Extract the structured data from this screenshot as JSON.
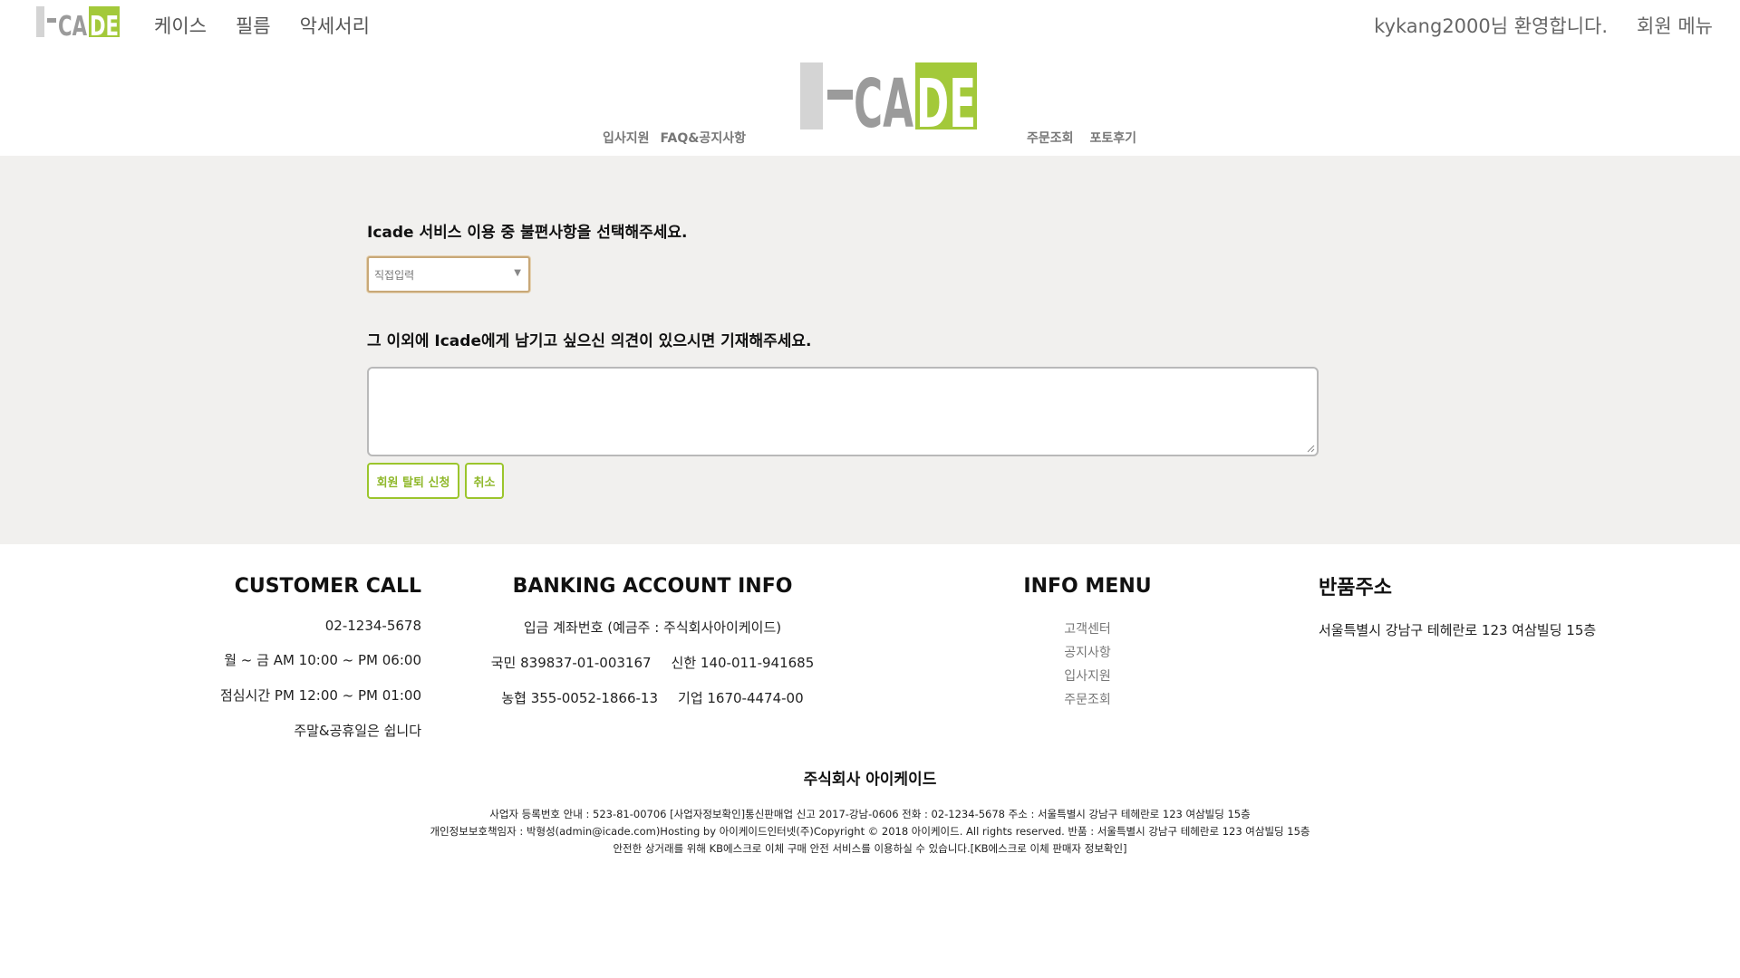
{
  "brand": {
    "logo_text_left": "I-CA",
    "logo_text_right": "DE",
    "colors": {
      "grey": "#9b9b9b",
      "light_grey": "#d4d4d4",
      "green": "#a3c93a"
    }
  },
  "header": {
    "top_nav": [
      "케이스",
      "필름",
      "악세서리"
    ],
    "welcome": "kykang2000님 환영합니다.",
    "member_menu": "회원 메뉴",
    "sub_nav_left": [
      "입사지원",
      "FAQ&공지사항"
    ],
    "sub_nav_right": [
      "주문조회",
      "포토후기"
    ]
  },
  "form": {
    "question1": "Icade 서비스 이용 중 불편사항을 선택해주세요.",
    "select_value": "직접입력",
    "question2": "그 이외에 Icade에게 남기고 싶으신 의견이 있으시면 기재해주세요.",
    "opinion_value": "",
    "withdraw_button": "회원 탈퇴 신청",
    "cancel_button": "취소"
  },
  "footer": {
    "customer_call": {
      "title": "CUSTOMER CALL",
      "lines": [
        "02-1234-5678",
        "월 ~ 금 AM 10:00 ~ PM 06:00",
        "점심시간 PM 12:00 ~ PM 01:00",
        "주말&공휴일은 쉽니다"
      ]
    },
    "banking": {
      "title": "BANKING ACCOUNT INFO",
      "holder": "입금 계좌번호 (예금주 : 주식회사아이케이드)",
      "accounts": [
        [
          "국민 839837-01-003167",
          "신한 140-011-941685"
        ],
        [
          "농협 355-0052-1866-13",
          "기업 1670-4474-00"
        ]
      ]
    },
    "info_menu": {
      "title": "INFO MENU",
      "items": [
        "고객센터",
        "공지사항",
        "입사지원",
        "주문조회"
      ]
    },
    "return_address": {
      "title": "반품주소",
      "address": "서울특별시 강남구 테헤란로 123 여삼빌딩 15층"
    },
    "company_name": "주식회사 아이케이드",
    "legal_lines": [
      "사업자 등록번호 안내 : 523-81-00706 [사업자정보확인]통신판매업 신고 2017-강남-0606 전화 : 02-1234-5678 주소 : 서울특별시 강남구 테헤란로 123 여삼빌딩 15층",
      "개인정보보호책임자 : 박형성(admin@icade.com)Hosting by 아이케이드인터넷(주)Copyright © 2018 아이케이드. All rights reserved. 반품 : 서울특별시 강남구 테헤란로 123 여삼빌딩 15층",
      "안전한 상거래를 위해 KB에스크로 이체 구매 안전 서비스를 이용하실 수 있습니다.[KB에스크로 이체 판매자 정보확인]"
    ]
  }
}
